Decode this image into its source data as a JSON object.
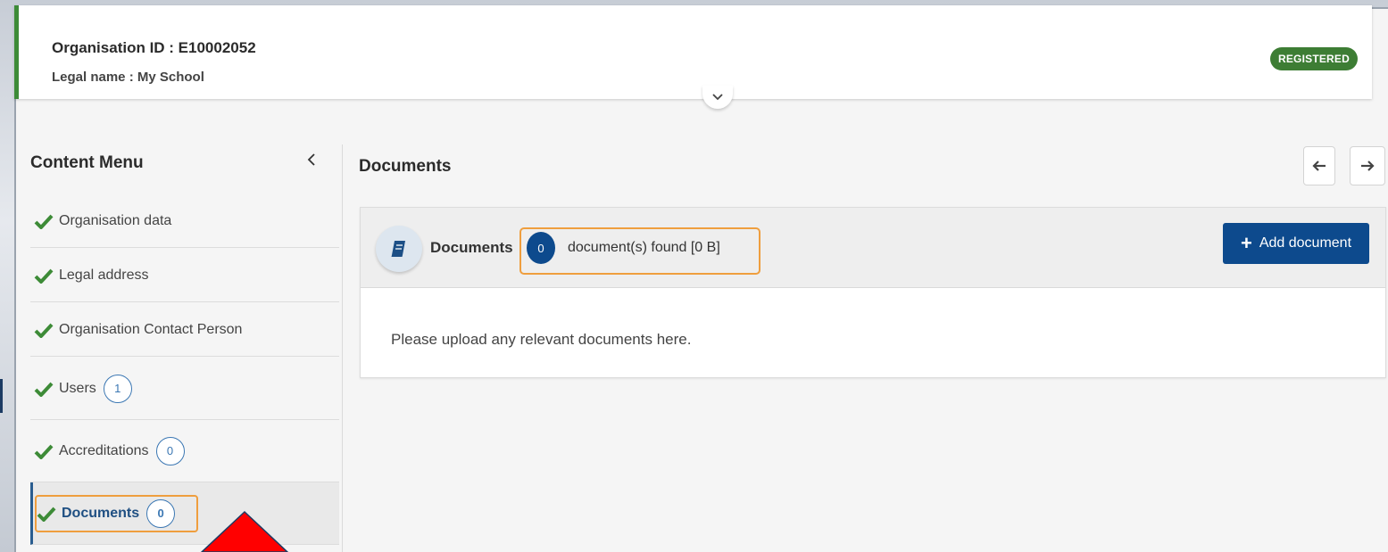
{
  "header": {
    "org_id": "Organisation ID : E10002052",
    "legal_name": "Legal name : My School",
    "status": "REGISTERED"
  },
  "sidebar": {
    "title": "Content Menu",
    "items": [
      {
        "label": "Organisation data"
      },
      {
        "label": "Legal address"
      },
      {
        "label": "Organisation Contact Person"
      },
      {
        "label": "Users",
        "count": "1"
      },
      {
        "label": "Accreditations",
        "count": "0"
      },
      {
        "label": "Documents",
        "count": "0"
      }
    ]
  },
  "main": {
    "title": "Documents",
    "panel": {
      "title": "Documents",
      "count": "0",
      "found_text": "document(s) found [0 B]",
      "add_button_label": "Add document",
      "empty_message": "Please upload any relevant documents here."
    }
  },
  "colors": {
    "accent_green": "#3d8b37",
    "primary_blue": "#0d4a8d",
    "highlight_orange": "#ef9e3e",
    "annotation_red": "#ff0000"
  },
  "icons": [
    "chevron-down-icon",
    "chevron-left-icon",
    "check-icon",
    "arrow-left-icon",
    "arrow-right-icon",
    "book-icon",
    "plus-icon"
  ]
}
